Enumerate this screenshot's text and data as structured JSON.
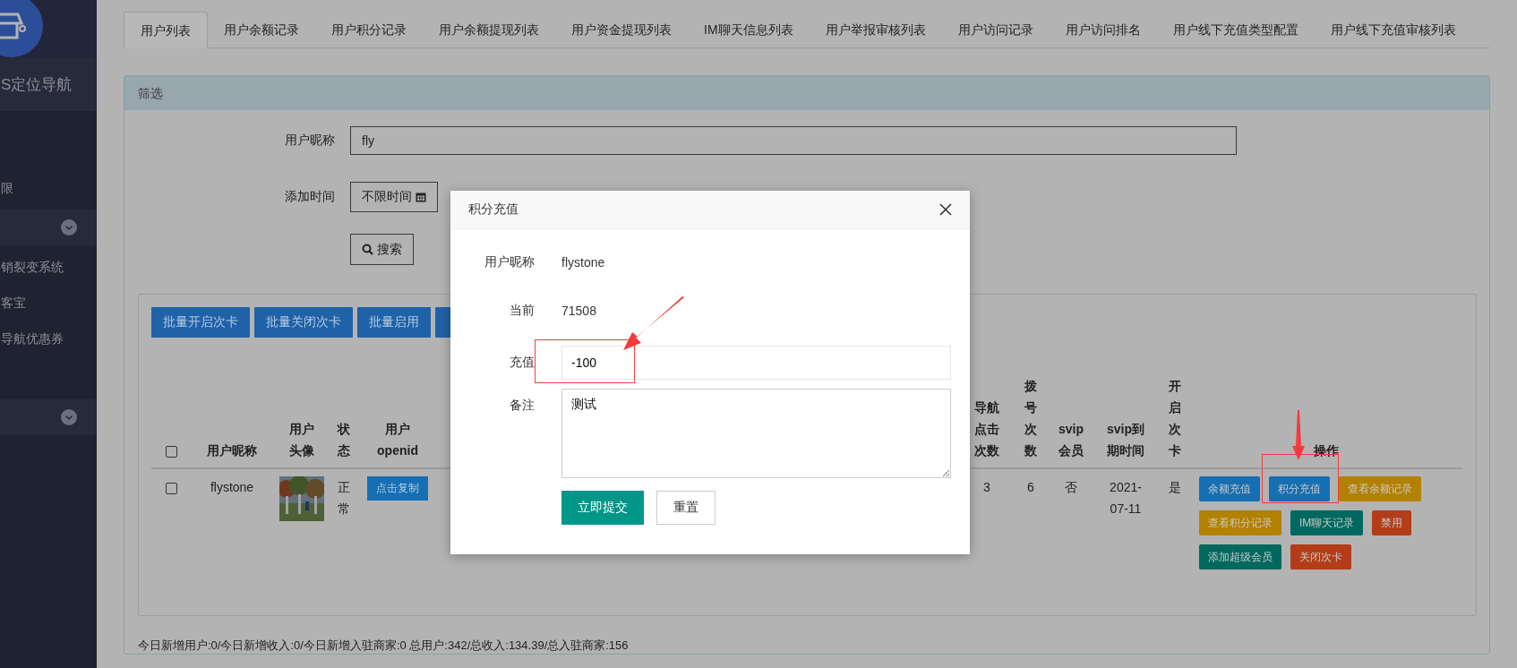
{
  "sidebar": {
    "brand": "S定位导航",
    "items": [
      {
        "kind": "item",
        "label": "限"
      },
      {
        "kind": "group"
      },
      {
        "kind": "item",
        "label": "销裂变系统"
      },
      {
        "kind": "item",
        "label": "客宝"
      },
      {
        "kind": "item",
        "label": "导航优惠券"
      },
      {
        "kind": "group"
      }
    ]
  },
  "tabs": [
    {
      "label": "用户列表",
      "selected": true
    },
    {
      "label": "用户余额记录",
      "selected": false
    },
    {
      "label": "用户积分记录",
      "selected": false
    },
    {
      "label": "用户余额提现列表",
      "selected": false
    },
    {
      "label": "用户资金提现列表",
      "selected": false
    },
    {
      "label": "IM聊天信息列表",
      "selected": false
    },
    {
      "label": "用户举报审核列表",
      "selected": false
    },
    {
      "label": "用户访问记录",
      "selected": false
    },
    {
      "label": "用户访问排名",
      "selected": false
    },
    {
      "label": "用户线下充值类型配置",
      "selected": false
    },
    {
      "label": "用户线下充值审核列表",
      "selected": false
    }
  ],
  "filter": {
    "title": "筛选",
    "nickname_label": "用户昵称",
    "nickname_value": "fly",
    "date_label": "添加时间",
    "date_value": "不限时间",
    "search_button": "搜索"
  },
  "batch_buttons": [
    "批量开启次卡",
    "批量关闭次卡",
    "批量启用"
  ],
  "covered_batch_button": true,
  "table": {
    "select_all_checked": false,
    "columns_left": [
      "用户昵称",
      "用户头像",
      "状态",
      "用户openid"
    ],
    "columns_right": [
      "导航点击次数",
      "拨号次数",
      "svip会员",
      "svip到期时间",
      "开启次卡",
      "操作"
    ],
    "rows": [
      {
        "checked": false,
        "nickname": "flystone",
        "status": "正常",
        "openid_button": "点击复制",
        "nav_clicks": "3",
        "dial_count": "6",
        "svip": "否",
        "svip_expiry": "2021-07-11",
        "card_open": "是",
        "actions": [
          {
            "label": "余额充值",
            "color": "#156fb2"
          },
          {
            "label": "积分充值",
            "color": "#156fb2"
          },
          {
            "label": "查看余额记录",
            "color": "#b28100"
          },
          {
            "label": "查看积分记录",
            "color": "#b28100"
          },
          {
            "label": "IM聊天记录",
            "color": "#00695f"
          },
          {
            "label": "禁用",
            "color": "#b23d18"
          },
          {
            "label": "添加超级会员",
            "color": "#00695f"
          },
          {
            "label": "关闭次卡",
            "color": "#b23d18"
          }
        ]
      }
    ]
  },
  "footer": "今日新增用户:0/今日新增收入:0/今日新增入驻商家:0 总用户:342/总收入:134.39/总入驻商家:156",
  "modal": {
    "title": "积分充值",
    "nickname_label": "用户昵称",
    "nickname": "flystone",
    "current_label": "当前",
    "current": "71508",
    "amount_label": "充值",
    "amount_value": "-100",
    "note_label": "备注",
    "note_value": "测试",
    "submit": "立即提交",
    "reset": "重置"
  }
}
